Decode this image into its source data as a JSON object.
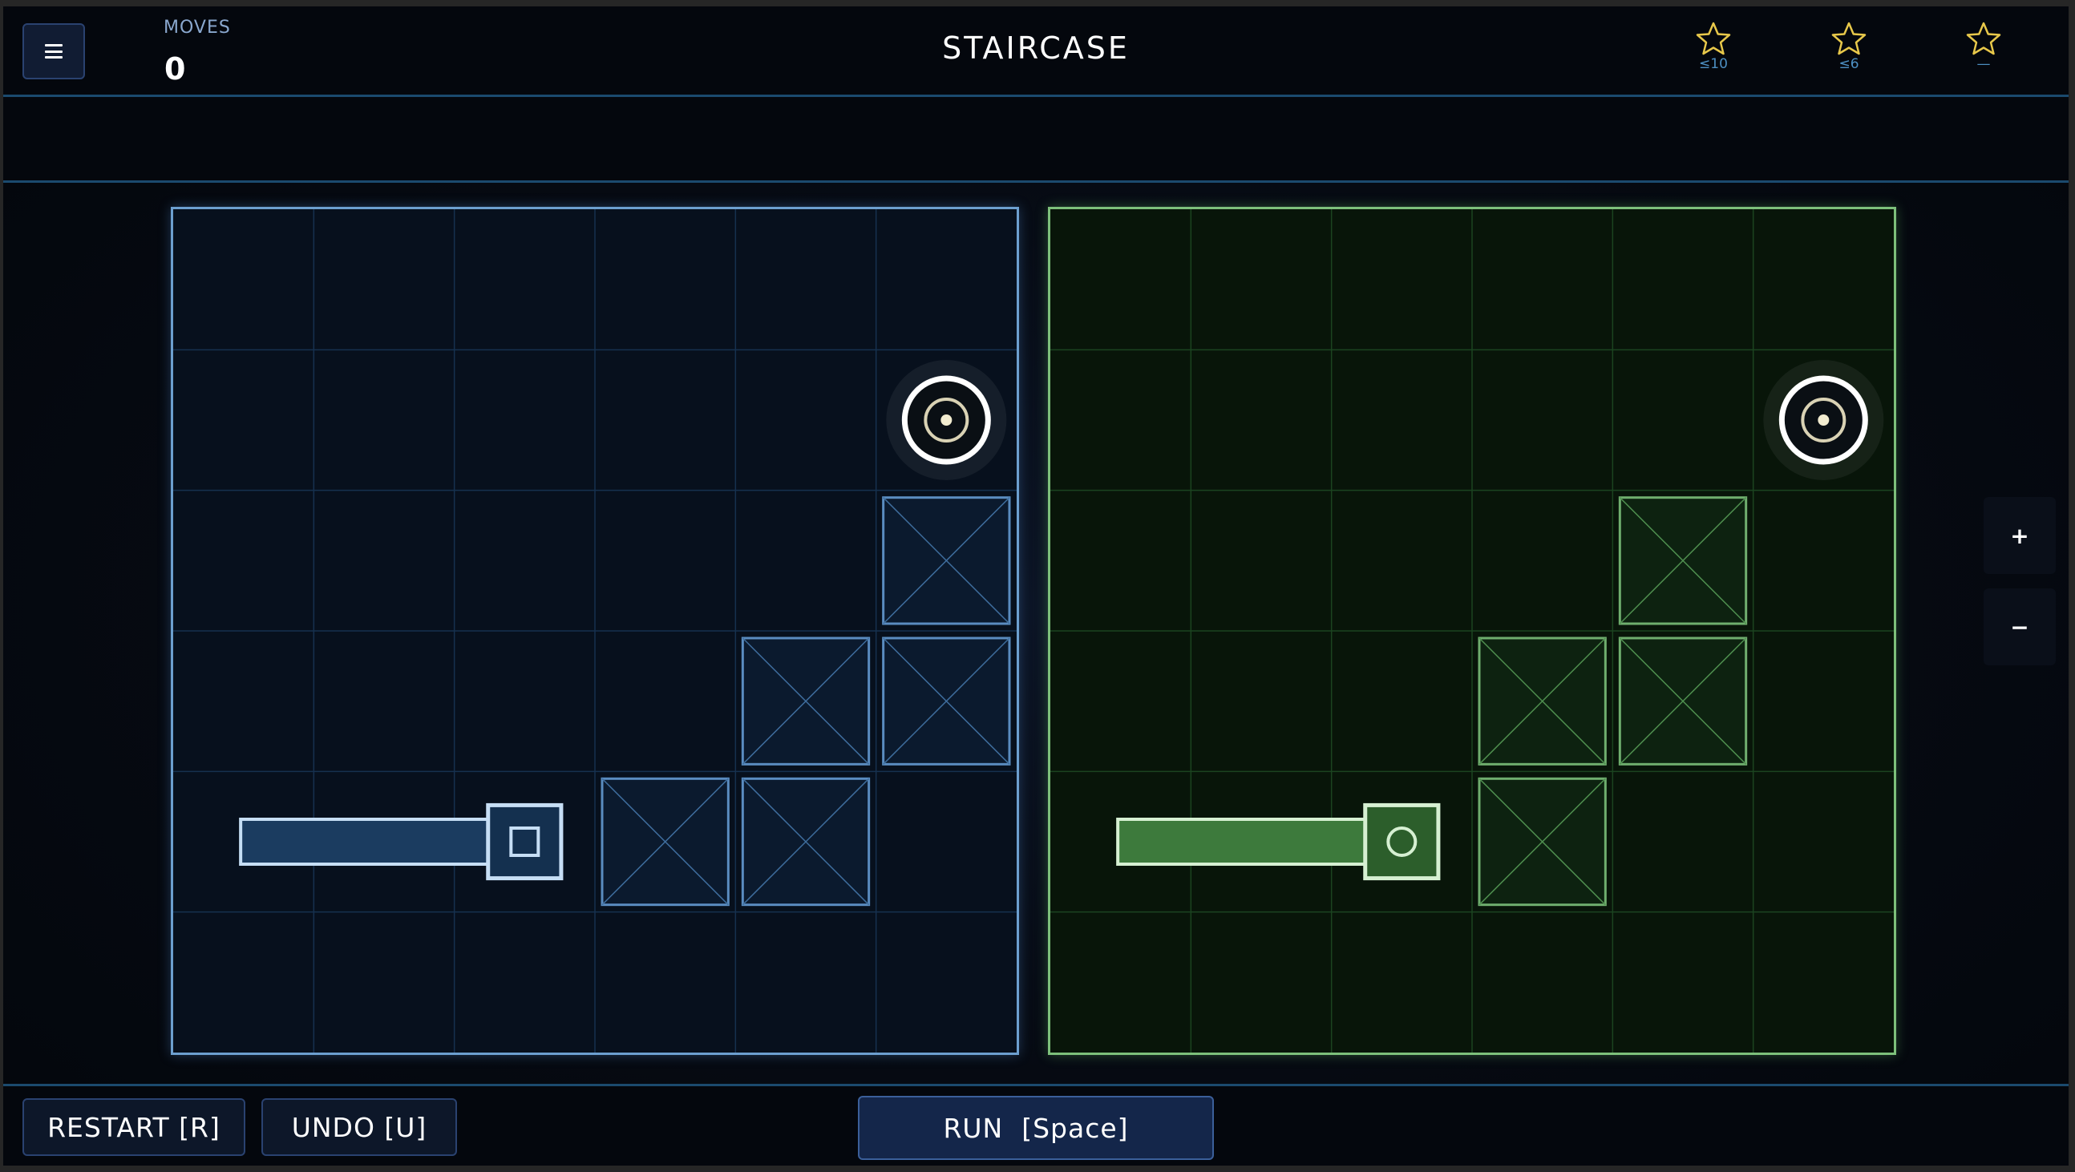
{
  "header": {
    "menu_icon": "hamburger-menu-icon",
    "moves_label": "MOVES",
    "moves_value": "0",
    "level_title": "STAIRCASE",
    "star_goals": [
      {
        "icon": "star-outline-icon",
        "goal": "≤10"
      },
      {
        "icon": "star-outline-icon",
        "goal": "≤6"
      },
      {
        "icon": "star-outline-icon",
        "goal": "—"
      }
    ],
    "star_color": "#e8c84a"
  },
  "zoom": {
    "in_label": "+",
    "out_label": "−"
  },
  "footer": {
    "restart_label": "RESTART [R]",
    "undo_label": "UNDO [U]",
    "run_label": "RUN  [Space]"
  },
  "boards": {
    "grid_size": 6,
    "left": {
      "theme_color": "#6c9fcf",
      "target": {
        "col": 5,
        "row": 1
      },
      "crates": [
        [
          5,
          2
        ],
        [
          4,
          3
        ],
        [
          5,
          3
        ],
        [
          3,
          4
        ],
        [
          4,
          4
        ]
      ],
      "piston": {
        "head_col": 2,
        "row": 4,
        "arm_from_col": 0,
        "head_symbol": "square"
      }
    },
    "right": {
      "theme_color": "#7dc07b",
      "target": {
        "col": 5,
        "row": 1
      },
      "crates": [
        [
          4,
          2
        ],
        [
          3,
          3
        ],
        [
          4,
          3
        ],
        [
          3,
          4
        ]
      ],
      "piston": {
        "head_col": 2,
        "row": 4,
        "arm_from_col": 0,
        "head_symbol": "circle"
      }
    }
  }
}
